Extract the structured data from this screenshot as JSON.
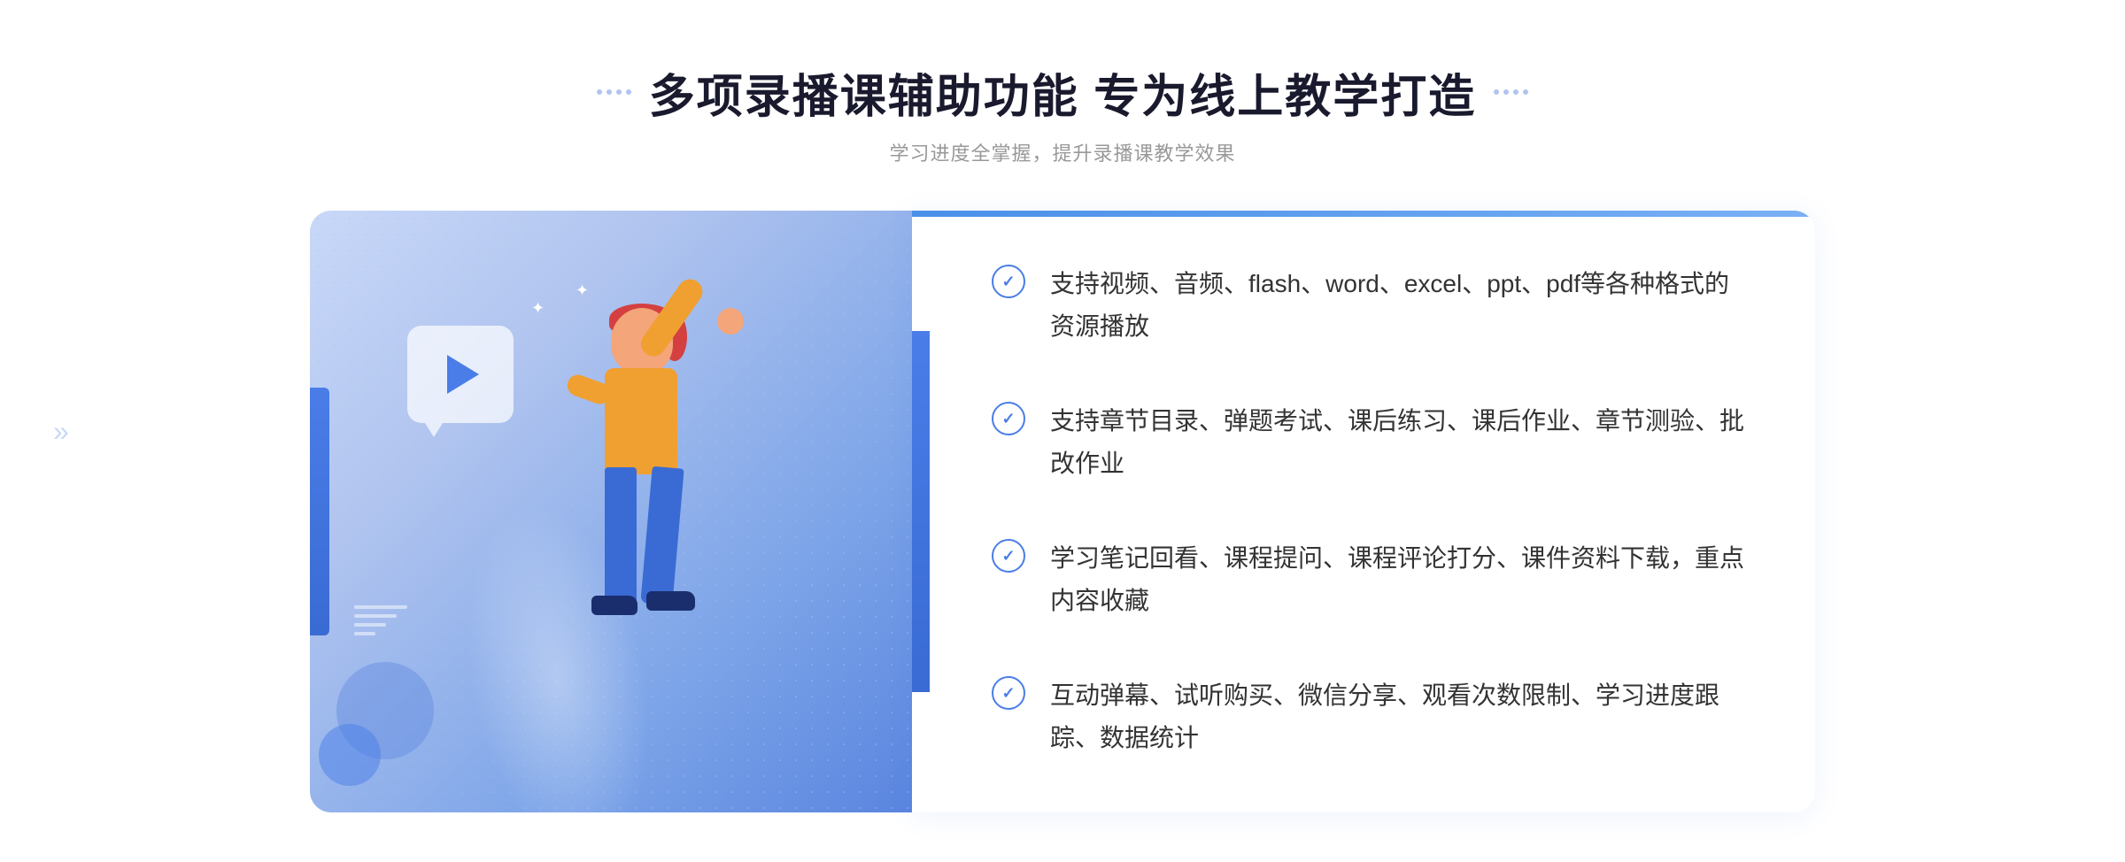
{
  "header": {
    "title": "多项录播课辅助功能 专为线上教学打造",
    "subtitle": "学习进度全掌握，提升录播课教学效果",
    "dots_left": "⁘",
    "dots_right": "⁘"
  },
  "features": [
    {
      "id": 1,
      "text": "支持视频、音频、flash、word、excel、ppt、pdf等各种格式的资源播放"
    },
    {
      "id": 2,
      "text": "支持章节目录、弹题考试、课后练习、课后作业、章节测验、批改作业"
    },
    {
      "id": 3,
      "text": "学习笔记回看、课程提问、课程评论打分、课件资料下载，重点内容收藏"
    },
    {
      "id": 4,
      "text": "互动弹幕、试听购买、微信分享、观看次数限制、学习进度跟踪、数据统计"
    }
  ],
  "colors": {
    "primary_blue": "#4a7de8",
    "light_blue": "#b0c4ef",
    "title_dark": "#1a1a2e",
    "text_gray": "#333333",
    "subtitle_gray": "#999999"
  },
  "chevron_left": "«"
}
